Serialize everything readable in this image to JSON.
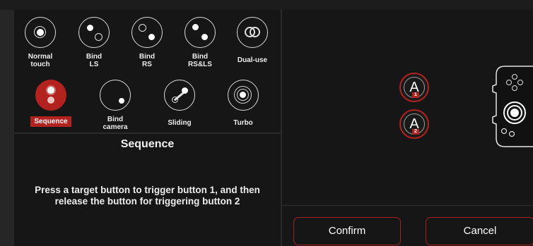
{
  "modes": [
    {
      "label": "Normal\ntouch",
      "icon": "normal-touch-icon"
    },
    {
      "label": "Bind\nLS",
      "icon": "bind-ls-icon"
    },
    {
      "label": "Bind\nRS",
      "icon": "bind-rs-icon"
    },
    {
      "label": "Bind\nRS&LS",
      "icon": "bind-rs-ls-icon"
    },
    {
      "label": "Dual-use",
      "icon": "dual-use-icon"
    },
    {
      "label": "Sequence",
      "icon": "sequence-icon",
      "selected": true
    },
    {
      "label": "Bind\ncamera",
      "icon": "bind-camera-icon"
    },
    {
      "label": "Sliding",
      "icon": "sliding-icon"
    },
    {
      "label": "Turbo",
      "icon": "turbo-icon"
    }
  ],
  "detail": {
    "title": "Sequence",
    "description": "Press a target button to trigger button 1, and then release the button for triggering button 2"
  },
  "preview": {
    "button1": {
      "letter": "A",
      "badge": "1"
    },
    "button2": {
      "letter": "A",
      "badge": "2"
    }
  },
  "actions": {
    "confirm": "Confirm",
    "cancel": "Cancel"
  },
  "colors": {
    "accent": "#b2221f",
    "panel": "#161616",
    "background": "#262626"
  }
}
